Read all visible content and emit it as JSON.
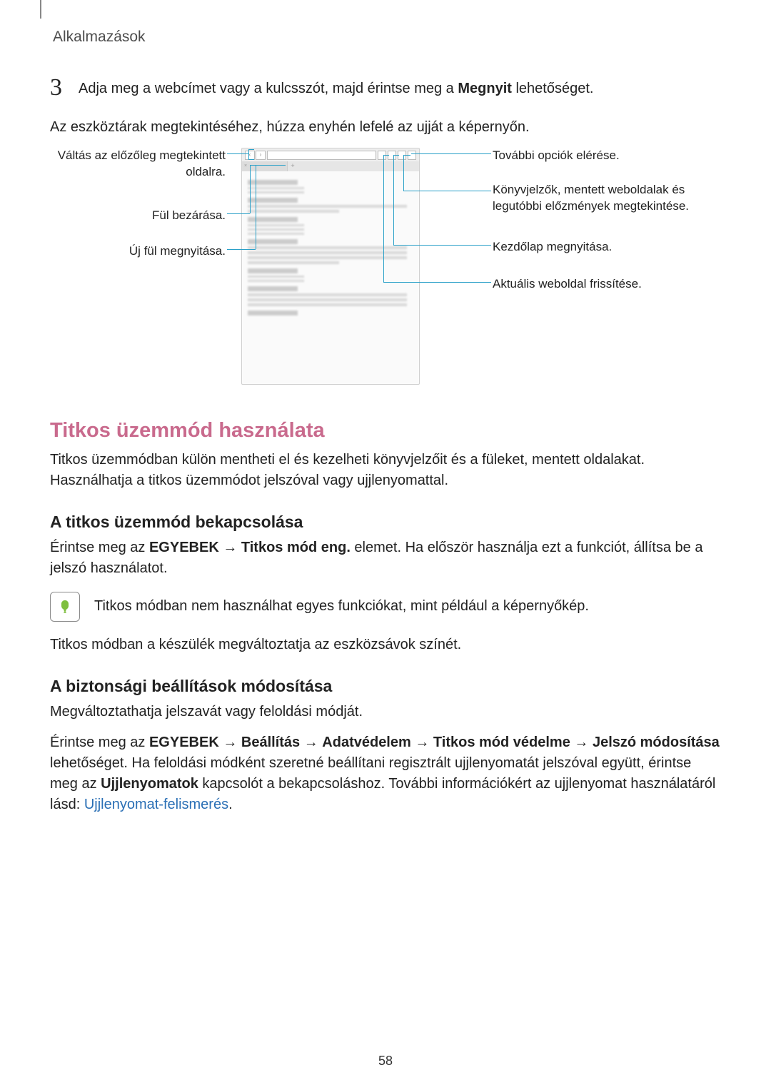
{
  "header": {
    "title": "Alkalmazások"
  },
  "step": {
    "num": "3",
    "part1": "Adja meg a webcímet vagy a kulcsszót, majd érintse meg a ",
    "bold": "Megnyit",
    "part2": " lehetőséget."
  },
  "pre_diagram": "Az eszköztárak megtekintéséhez, húzza enyhén lefelé az ujját a képernyőn.",
  "callouts_left": {
    "prev_page": "Váltás az előzőleg megtekintett oldalra.",
    "close_tab": "Fül bezárása.",
    "new_tab": "Új fül megnyitása."
  },
  "callouts_right": {
    "more": "További opciók elérése.",
    "bookmarks": "Könyvjelzők, mentett weboldalak és legutóbbi előzmények megtekintése.",
    "home": "Kezdőlap megnyitása.",
    "refresh": "Aktuális weboldal frissítése."
  },
  "secret": {
    "heading": "Titkos üzemmód használata",
    "intro": "Titkos üzemmódban külön mentheti el és kezelheti könyvjelzőit és a füleket, mentett oldalakat. Használhatja a titkos üzemmódot jelszóval vagy ujjlenyomattal.",
    "enable_heading": "A titkos üzemmód bekapcsolása",
    "enable_p1a": "Érintse meg az ",
    "enable_p1b": "EGYEBEK",
    "enable_p1c": " → ",
    "enable_p1d": "Titkos mód eng.",
    "enable_p1e": " elemet. Ha először használja ezt a funkciót, állítsa be a jelszó használatot.",
    "note": "Titkos módban nem használhat egyes funkciókat, mint például a képernyőkép.",
    "after_note": "Titkos módban a készülék megváltoztatja az eszközsávok színét.",
    "sec_heading": "A biztonsági beállítások módosítása",
    "sec_p1": "Megváltoztathatja jelszavát vagy feloldási módját.",
    "sec_p2a": "Érintse meg az ",
    "sec_p2b": "EGYEBEK",
    "sec_p2c": " → ",
    "sec_p2d": "Beállítás",
    "sec_p2e": " → ",
    "sec_p2f": "Adatvédelem",
    "sec_p2g": " → ",
    "sec_p2h": "Titkos mód védelme",
    "sec_p2i": " → ",
    "sec_p2j": "Jelszó módosítása",
    "sec_p2k": " lehetőséget. Ha feloldási módként szeretné beállítani regisztrált ujjlenyomatát jelszóval együtt, érintse meg az ",
    "sec_p2l": "Ujjlenyomatok",
    "sec_p2m": " kapcsolót a bekapcsoláshoz. További információkért az ujjlenyomat használatáról lásd: ",
    "sec_link": "Ujjlenyomat-felismerés",
    "sec_p2n": "."
  },
  "page_number": "58"
}
